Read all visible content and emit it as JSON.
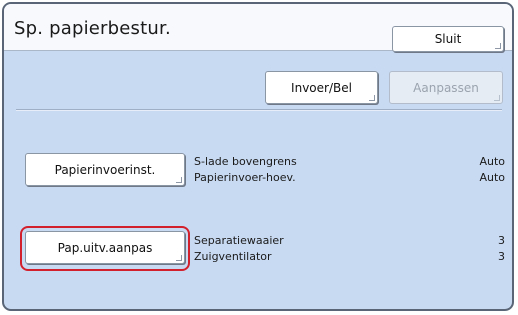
{
  "title": "Sp. papierbestur.",
  "buttons": {
    "close": "Sluit",
    "feed": "Invoer/Bel",
    "adjust": "Aanpassen",
    "paper_feed_settings": "Papierinvoerinst.",
    "paper_output_adjust": "Pap.uitv.aanpas"
  },
  "feed_settings": [
    {
      "label": "S-lade bovengrens",
      "value": "Auto"
    },
    {
      "label": "Papierinvoer-hoev.",
      "value": "Auto"
    }
  ],
  "output_settings": [
    {
      "label": "Separatiewaaier",
      "value": "3"
    },
    {
      "label": "Zuigventilator",
      "value": "3"
    }
  ],
  "colors": {
    "panel_bg": "#c8daf2",
    "highlight": "#d3202d"
  }
}
